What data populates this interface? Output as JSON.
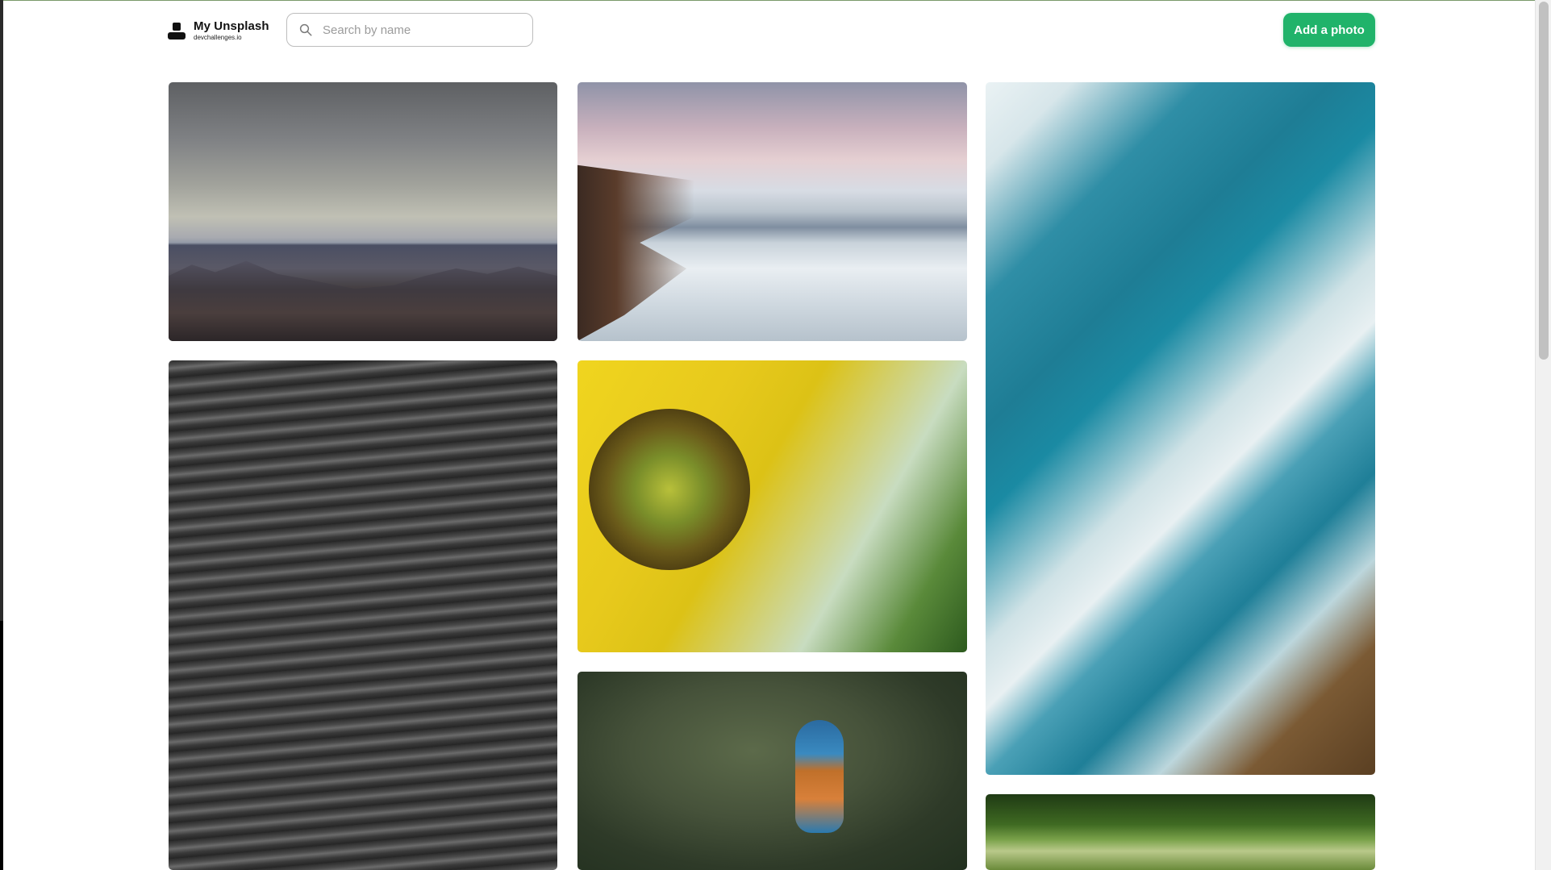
{
  "header": {
    "logo_title": "My Unsplash",
    "logo_subtitle": "devchallenges.io",
    "search_placeholder": "Search by name",
    "search_value": "",
    "add_button_label": "Add a photo"
  },
  "colors": {
    "accent": "#20b36a",
    "search_border": "#bdbdbd"
  },
  "icons": {
    "search": "search-icon",
    "logo": "logo-icon"
  },
  "gallery": {
    "photos": [
      {
        "subject": "desert-mountains"
      },
      {
        "subject": "beach-shore"
      },
      {
        "subject": "aerial-waves"
      },
      {
        "subject": "gray-sea"
      },
      {
        "subject": "sunflower"
      },
      {
        "subject": "kingfisher"
      },
      {
        "subject": "forest"
      }
    ]
  }
}
